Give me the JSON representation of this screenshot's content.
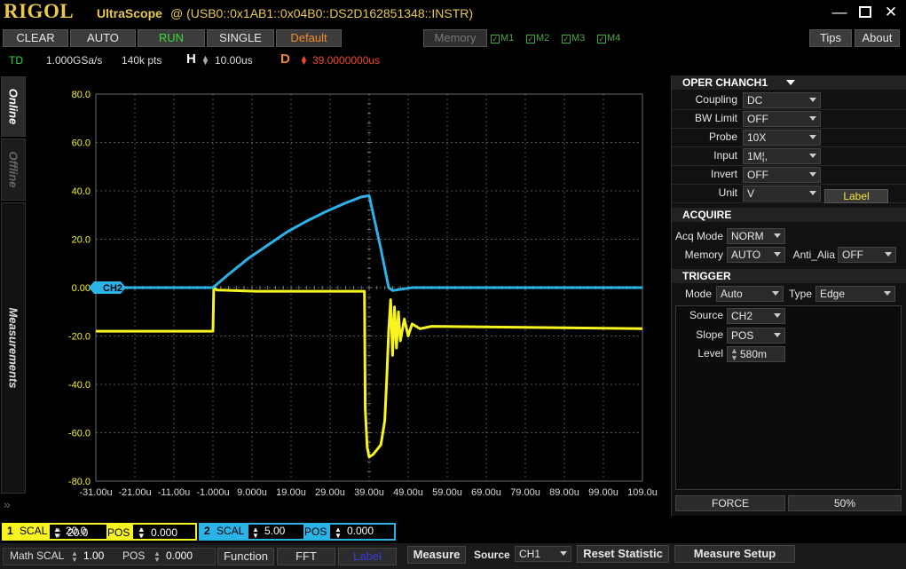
{
  "titlebar": {
    "brand": "RIGOL",
    "product": "UltraScope",
    "resource": "@ (USB0::0x1AB1::0x04B0::DS2D162851348::INSTR)"
  },
  "toolbar": {
    "clear": "CLEAR",
    "auto": "AUTO",
    "run": "RUN",
    "single": "SINGLE",
    "default": "Default",
    "memory": "Memory",
    "m1": "M1",
    "m2": "M2",
    "m3": "M3",
    "m4": "M4",
    "tips": "Tips",
    "about": "About"
  },
  "info": {
    "td": "TD",
    "sample_rate": "1.000GSa/s",
    "points": "140k pts",
    "h_label": "H",
    "h_value": "10.00us",
    "d_label": "D",
    "d_value": "39.0000000us"
  },
  "sidetabs": {
    "online": "Online",
    "offline": "Offline",
    "measurements": "Measurements"
  },
  "chart_data": {
    "type": "line",
    "y_ticks": [
      "80.0",
      "60.0",
      "40.0",
      "20.0",
      "0.00",
      "-20.0",
      "-40.0",
      "-60.0",
      "-80.0"
    ],
    "x_ticks": [
      "-31.00u",
      "-21.00u",
      "-11.00u",
      "-1.000u",
      "9.000u",
      "19.00u",
      "29.00u",
      "39.00u",
      "49.00u",
      "59.00u",
      "69.00u",
      "79.00u",
      "89.00u",
      "99.00u",
      "109.0u"
    ],
    "xlim": [
      -31,
      109
    ],
    "ylim": [
      -80,
      80
    ],
    "marker_label": "CH2",
    "series": [
      {
        "name": "CH2",
        "color": "#2bb3e8",
        "x": [
          -31,
          -1,
          3,
          8,
          13,
          18,
          23,
          28,
          33,
          37,
          39,
          42,
          44,
          45,
          50,
          109
        ],
        "y": [
          0,
          0,
          5.5,
          12,
          17.5,
          23,
          27.5,
          31.5,
          35,
          37.5,
          38,
          16,
          0,
          -1.2,
          0,
          0
        ]
      },
      {
        "name": "CH1",
        "color": "#f7f41f",
        "x": [
          -31,
          -1,
          -0.8,
          0,
          10,
          20,
          30,
          37.8,
          38,
          38.5,
          39,
          40,
          41,
          42,
          43,
          43.5,
          44,
          44.5,
          45,
          45.5,
          46,
          46.5,
          47,
          48,
          49,
          50,
          52,
          55,
          109
        ],
        "y": [
          -18,
          -18,
          0,
          -1,
          -1.5,
          -1.5,
          -1.5,
          -1.5,
          -50,
          -66,
          -70,
          -69,
          -67,
          -65,
          -55,
          -38,
          -18,
          -5,
          -28,
          -8,
          -25,
          -10,
          -22,
          -13,
          -20,
          -15,
          -17,
          -16,
          -17
        ]
      }
    ]
  },
  "oper": {
    "title": "OPER CHAN",
    "channel": "CH1",
    "rows": [
      {
        "label": "Coupling",
        "value": "DC"
      },
      {
        "label": "BW Limit",
        "value": "OFF"
      },
      {
        "label": "Probe",
        "value": "10X"
      },
      {
        "label": "Input",
        "value": "1M¦,"
      },
      {
        "label": "Invert",
        "value": "OFF"
      },
      {
        "label": "Unit",
        "value": "V"
      }
    ],
    "label_btn": "Label"
  },
  "acquire": {
    "title": "ACQUIRE",
    "acq_mode_label": "Acq Mode",
    "acq_mode": "NORM",
    "memory_label": "Memory",
    "memory": "AUTO",
    "anti_alias_label": "Anti_Alia",
    "anti_alias": "OFF"
  },
  "trigger": {
    "title": "TRIGGER",
    "mode_label": "Mode",
    "mode": "Auto",
    "type_label": "Type",
    "type": "Edge",
    "source_label": "Source",
    "source": "CH2",
    "slope_label": "Slope",
    "slope": "POS",
    "level_label": "Level",
    "level": "580m",
    "force": "FORCE",
    "percent": "50%"
  },
  "bottom": {
    "ch1_num": "1",
    "ch1_scal_label": "SCAL",
    "ch1_scal": "20.0",
    "ch1_pos_label": "POS",
    "ch1_pos": "0.000",
    "ch2_num": "2",
    "ch2_scal_label": "SCAL",
    "ch2_scal": "5.00",
    "ch2_pos_label": "POS",
    "ch2_pos": "0.000",
    "math_scal_label": "Math SCAL",
    "math_scal": "1.00",
    "math_pos_label": "POS",
    "math_pos": "0.000",
    "function": "Function",
    "fft": "FFT",
    "label": "Label",
    "measure": "Measure",
    "source_label": "Source",
    "source": "CH1",
    "reset_statistic": "Reset  Statistic",
    "measure_setup": "Measure Setup"
  }
}
